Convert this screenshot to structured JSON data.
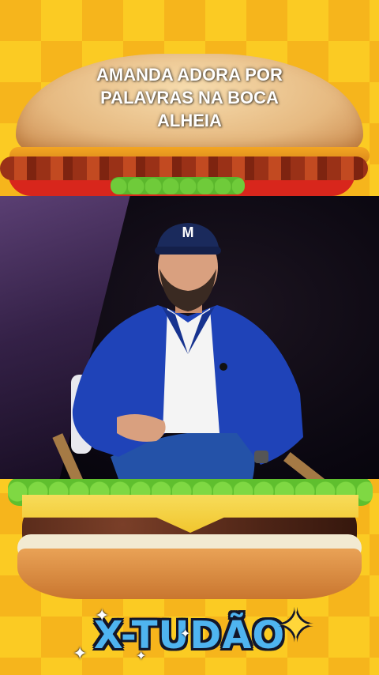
{
  "caption": {
    "line1": "AMANDA ADORA POR",
    "line2": "PALAVRAS NA BOCA",
    "line3": "ALHEIA"
  },
  "cap": {
    "letter": "M"
  },
  "title": {
    "text": "X-TUDÃO"
  },
  "icons": {
    "sparkle": "sparkle-icon",
    "star": "four-point-star-icon"
  },
  "colors": {
    "background": "#f6b51c",
    "title_fill": "#4fb4f0",
    "title_outline": "#12162a",
    "jacket": "#1f43b8"
  }
}
